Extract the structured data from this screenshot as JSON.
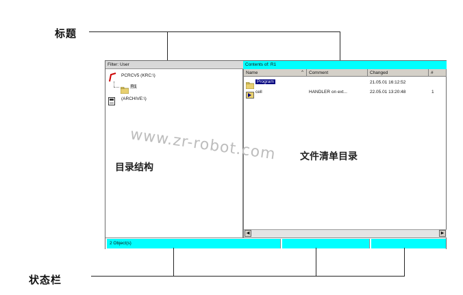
{
  "callouts": {
    "title": "标题",
    "status_bar": "状态栏"
  },
  "area_labels": {
    "directory_structure": "目录结构",
    "file_list_directory": "文件清单目录"
  },
  "watermark": "www.zr-robot.com",
  "window": {
    "left_pane_title": "Filter: User",
    "right_pane_title": "Contents of: R1",
    "tree": [
      {
        "label": "PCRCV5 (KRC:\\)",
        "icon": "robot-icon"
      },
      {
        "label": "R1",
        "icon": "folder-icon"
      },
      {
        "label": "(ARCHIVE:\\)",
        "icon": "archive-drive-icon"
      }
    ],
    "columns": [
      "Name",
      "Comment",
      "Changed",
      "#"
    ],
    "rows": [
      {
        "name": "Program",
        "comment": "",
        "changed": "21.05.01 16:12:52",
        "count": "",
        "icon": "folder-icon"
      },
      {
        "name": "cell",
        "comment": "HANDLER on ext...",
        "changed": "22.05.01 13:20:48",
        "count": "1",
        "icon": "program-icon"
      }
    ],
    "status_text": "2 Object(s)"
  },
  "colors": {
    "title_bar": "#00ffff",
    "status_bar": "#00ffff",
    "selection": "#000080"
  }
}
